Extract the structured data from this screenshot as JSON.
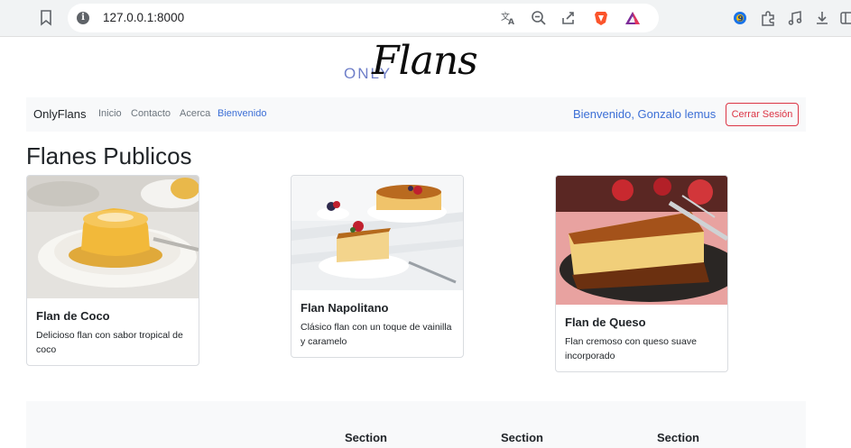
{
  "browser": {
    "url": "127.0.0.1:8000",
    "icons": [
      "bookmark-icon",
      "site-info-icon",
      "translate-icon",
      "zoom-out-icon",
      "share-icon",
      "brave-shield-icon",
      "brave-rewards-icon",
      "extension-badge-icon",
      "extensions-icon",
      "media-icon",
      "download-icon",
      "sidebar-icon"
    ]
  },
  "logo": {
    "small": "ONLY",
    "script": "Flans"
  },
  "navbar": {
    "brand": "OnlyFlans",
    "links": [
      "Inicio",
      "Contacto",
      "Acerca",
      "Bienvenido"
    ],
    "welcome": "Bienvenido, Gonzalo lemus",
    "logout": "Cerrar Sesión"
  },
  "main": {
    "title": "Flanes Publicos",
    "cards": [
      {
        "title": "Flan de Coco",
        "text": "Delicioso flan con sabor tropical de coco"
      },
      {
        "title": "Flan Napolitano",
        "text": "Clásico flan con un toque de vainilla y caramelo"
      },
      {
        "title": "Flan de Queso",
        "text": "Flan cremoso con queso suave incorporado"
      }
    ]
  },
  "footer": {
    "sections": [
      "Section",
      "Section",
      "Section"
    ]
  },
  "colors": {
    "accent": "#3c6fd6",
    "danger": "#dc3545",
    "navbar_bg": "#f8f9fa",
    "logo_only": "#6f7fc9"
  }
}
